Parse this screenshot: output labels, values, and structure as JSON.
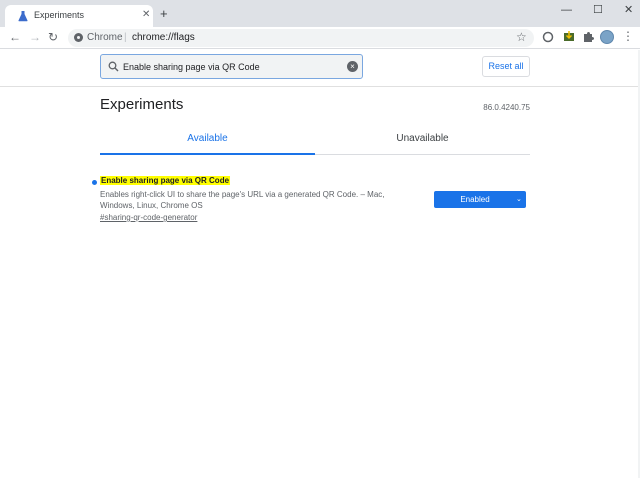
{
  "window": {
    "tab_title": "Experiments",
    "tab_close": "✕",
    "new_tab": "+",
    "minimize": "—",
    "maximize": "☐",
    "close": "✕"
  },
  "toolbar": {
    "back": "←",
    "forward": "→",
    "reload": "↻",
    "site_label": "Chrome",
    "separator": "|",
    "url": "chrome://flags",
    "star": "☆",
    "menu": "⋮"
  },
  "search": {
    "value": "Enable sharing page via QR Code",
    "clear": "×"
  },
  "reset_label": "Reset all",
  "page": {
    "title": "Experiments",
    "version": "86.0.4240.75"
  },
  "tabs": {
    "available": "Available",
    "unavailable": "Unavailable"
  },
  "experiment": {
    "title": "Enable sharing page via QR Code",
    "description": "Enables right-click UI to share the page's URL via a generated QR Code. – Mac, Windows, Linux, Chrome OS",
    "link": "#sharing-qr-code-generator",
    "value": "Enabled",
    "chevron": "⌄"
  },
  "colors": {
    "accent": "#1a73e8",
    "highlight": "#ffff00",
    "tabstrip": "#dee1e6"
  },
  "icons": {
    "favicon": "flask-icon",
    "site": "chrome-icon",
    "search": "search-icon",
    "clear": "clear-icon",
    "ext1": "circle-extension-icon",
    "ext2": "download-extension-icon",
    "ext3": "puzzle-icon",
    "avatar": "avatar"
  }
}
